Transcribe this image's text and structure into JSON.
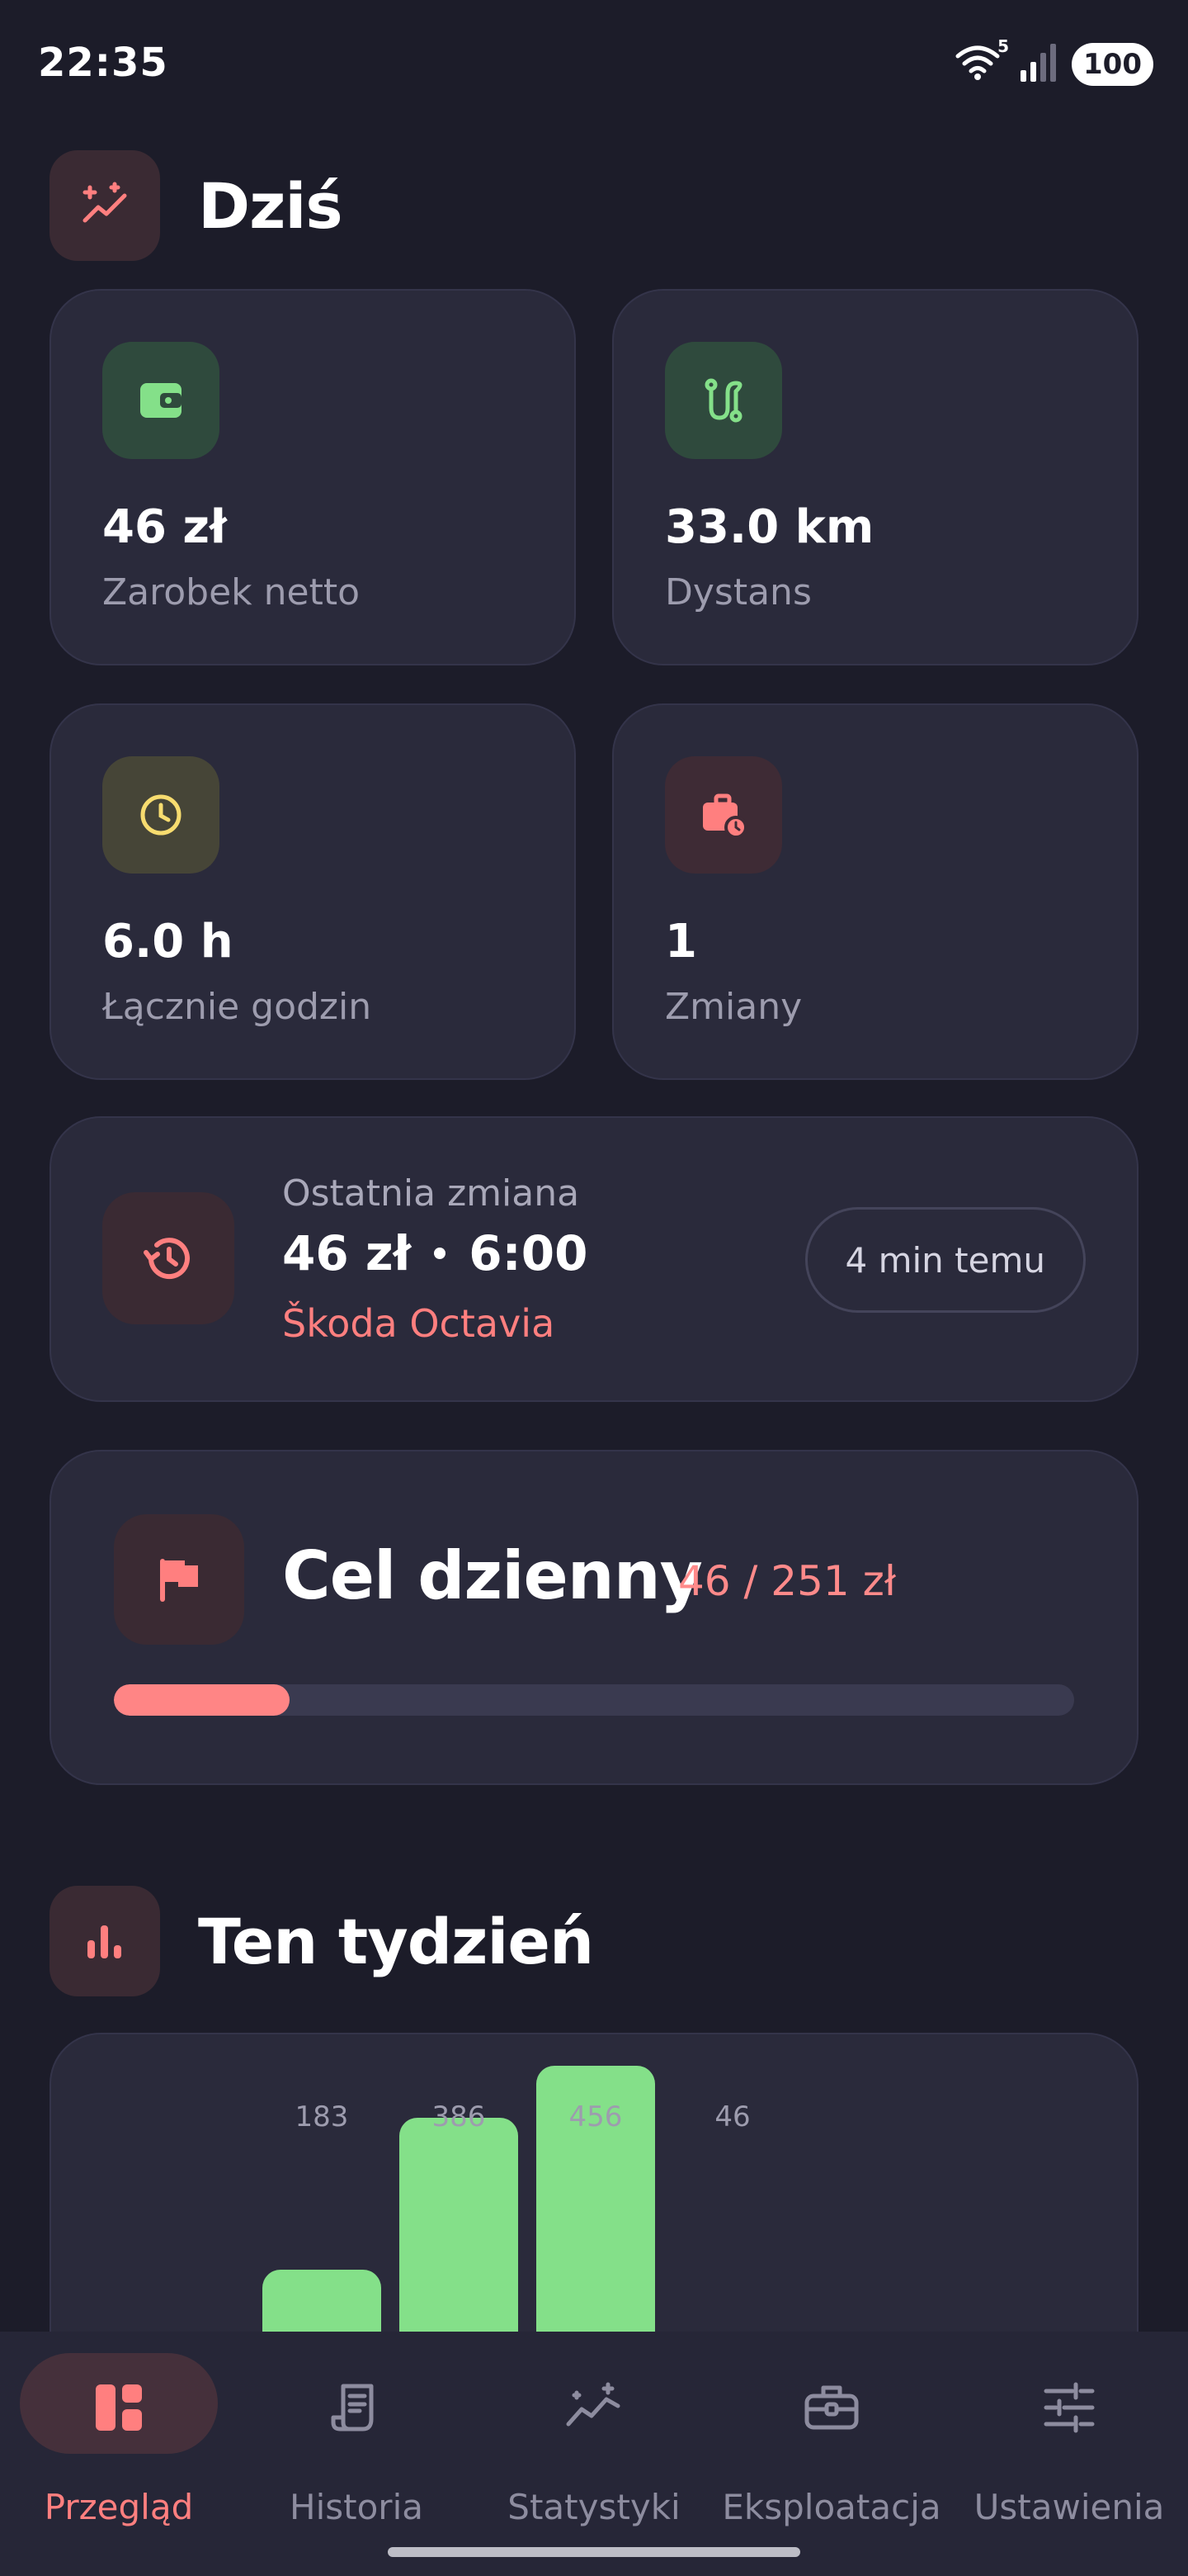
{
  "status_bar": {
    "time": "22:35",
    "battery": "100",
    "wifi_badge": "5"
  },
  "today": {
    "title": "Dziś",
    "stats": [
      {
        "value": "46 zł",
        "label": "Zarobek netto",
        "icon": "wallet-icon"
      },
      {
        "value": "33.0 km",
        "label": "Dystans",
        "icon": "route-icon"
      },
      {
        "value": "6.0 h",
        "label": "Łącznie godzin",
        "icon": "clock-icon"
      },
      {
        "value": "1",
        "label": "Zmiany",
        "icon": "briefcase-clock-icon"
      }
    ]
  },
  "last_shift": {
    "label": "Ostatnia zmiana",
    "amount": "46 zł",
    "duration": "6:00",
    "vehicle": "Škoda Octavia",
    "ago": "4 min temu"
  },
  "daily_goal": {
    "title": "Cel dzienny",
    "amount_text": "46 / 251 zł",
    "progress": 0.183
  },
  "week": {
    "title": "Ten tydzień",
    "chart_data": {
      "type": "bar",
      "values": [
        183,
        386,
        456,
        46
      ],
      "data_labels": [
        "183",
        "386",
        "456",
        "46"
      ]
    }
  },
  "nav": {
    "items": [
      {
        "label": "Przegląd",
        "icon": "dashboard-icon",
        "active": true
      },
      {
        "label": "Historia",
        "icon": "receipt-icon",
        "active": false
      },
      {
        "label": "Statystyki",
        "icon": "stats-icon",
        "active": false
      },
      {
        "label": "Eksploatacja",
        "icon": "toolbox-icon",
        "active": false
      },
      {
        "label": "Ustawienia",
        "icon": "sliders-icon",
        "active": false
      }
    ]
  },
  "colors": {
    "background": "#1c1c29",
    "card": "#2a2a3b",
    "accent": "#ff7f7f",
    "green": "#84e089",
    "yellow": "#f7dc6f"
  }
}
